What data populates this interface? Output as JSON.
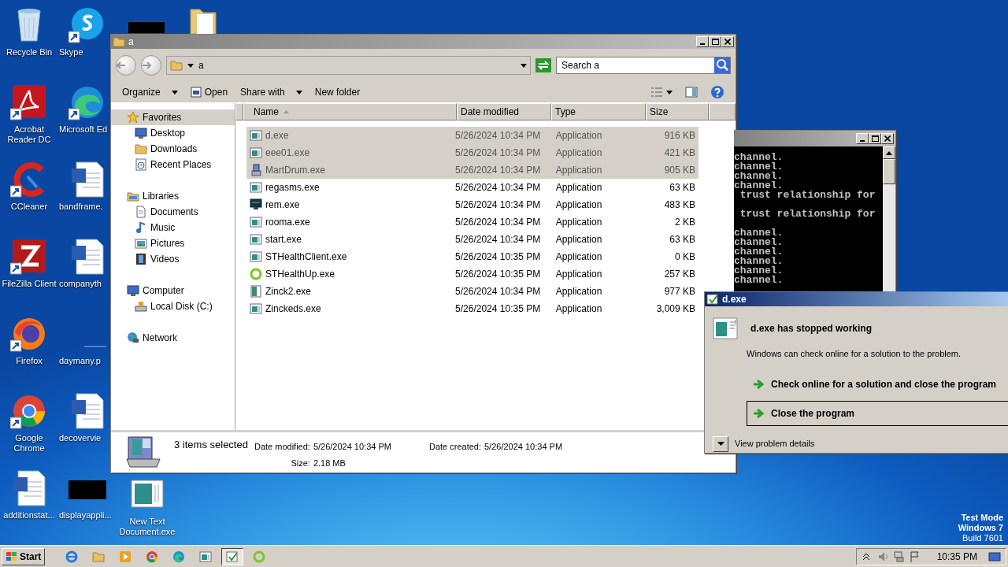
{
  "desktop": {
    "icons": [
      {
        "label": "Recycle Bin",
        "kind": "recycle",
        "shortcut": false
      },
      {
        "label": "Acrobat Reader DC",
        "kind": "acrobat",
        "shortcut": true
      },
      {
        "label": "CCleaner",
        "kind": "ccleaner",
        "shortcut": true
      },
      {
        "label": "FileZilla Client",
        "kind": "filezilla",
        "shortcut": true
      },
      {
        "label": "Firefox",
        "kind": "firefox",
        "shortcut": true
      },
      {
        "label": "Google Chrome",
        "kind": "chrome",
        "shortcut": true
      },
      {
        "label": "additionstat...",
        "kind": "word",
        "shortcut": false
      },
      {
        "label": "Skype",
        "kind": "skype",
        "shortcut": true
      },
      {
        "label": "Microsoft Ed",
        "kind": "edge",
        "shortcut": true
      },
      {
        "label": "bandframe.",
        "kind": "word",
        "shortcut": false
      },
      {
        "label": "companyth",
        "kind": "word",
        "shortcut": false
      },
      {
        "label": "daymany.p",
        "kind": "blank",
        "shortcut": false
      },
      {
        "label": "decovervie",
        "kind": "word",
        "shortcut": false
      },
      {
        "label": "displayappli...",
        "kind": "redacted",
        "shortcut": false
      }
    ],
    "loose_icons": [
      {
        "label": "New Text Document.exe",
        "kind": "exe",
        "shortcut": false
      }
    ],
    "info": [
      "Test Mode",
      "Windows 7",
      "Build 7601"
    ]
  },
  "explorer": {
    "title": "a",
    "address": "a",
    "search": {
      "placeholder": "Search a"
    },
    "toolbar": [
      {
        "label": "Organize",
        "kind": "text",
        "has_menu": true
      },
      {
        "label": "Open",
        "kind": "open",
        "has_menu": false
      },
      {
        "label": "Share with",
        "kind": "text",
        "has_menu": true
      },
      {
        "label": "New folder",
        "kind": "text",
        "has_menu": false
      }
    ],
    "sidebar": [
      {
        "label": "Favorites",
        "kind": "star",
        "selected": true,
        "children": [
          {
            "label": "Desktop",
            "kind": "desktop",
            "selected": false
          },
          {
            "label": "Downloads",
            "kind": "folder",
            "selected": false
          },
          {
            "label": "Recent Places",
            "kind": "recent",
            "selected": false
          }
        ]
      },
      {
        "label": "Libraries",
        "kind": "library",
        "selected": false,
        "children": [
          {
            "label": "Documents",
            "kind": "document",
            "selected": false
          },
          {
            "label": "Music",
            "kind": "music",
            "selected": false
          },
          {
            "label": "Pictures",
            "kind": "picture",
            "selected": false
          },
          {
            "label": "Videos",
            "kind": "video",
            "selected": false
          }
        ]
      },
      {
        "label": "Computer",
        "kind": "desktop",
        "selected": false,
        "children": [
          {
            "label": "Local Disk (C:)",
            "kind": "disk",
            "selected": false
          }
        ]
      },
      {
        "label": "Network",
        "kind": "network",
        "selected": false
      }
    ],
    "columns": [
      {
        "label": "Name",
        "sorted": true
      },
      {
        "label": "Date modified",
        "sorted": false
      },
      {
        "label": "Type",
        "sorted": false
      },
      {
        "label": "Size",
        "sorted": false
      }
    ],
    "rows": [
      {
        "name": "d.exe",
        "kind": "exe",
        "date": "5/26/2024 10:34 PM",
        "type": "Application",
        "size": "916 KB",
        "selected": true
      },
      {
        "name": "eee01.exe",
        "kind": "exe",
        "date": "5/26/2024 10:34 PM",
        "type": "Application",
        "size": "421 KB",
        "selected": true
      },
      {
        "name": "MartDrum.exe",
        "kind": "installer",
        "date": "5/26/2024 10:34 PM",
        "type": "Application",
        "size": "905 KB",
        "selected": true
      },
      {
        "name": "regasms.exe",
        "kind": "exe",
        "date": "5/26/2024 10:34 PM",
        "type": "Application",
        "size": "63 KB",
        "selected": false
      },
      {
        "name": "rem.exe",
        "kind": "monitor",
        "date": "5/26/2024 10:34 PM",
        "type": "Application",
        "size": "483 KB",
        "selected": false
      },
      {
        "name": "rooma.exe",
        "kind": "exe",
        "date": "5/26/2024 10:34 PM",
        "type": "Application",
        "size": "2 KB",
        "selected": false
      },
      {
        "name": "start.exe",
        "kind": "exe",
        "date": "5/26/2024 10:34 PM",
        "type": "Application",
        "size": "63 KB",
        "selected": false
      },
      {
        "name": "STHealthClient.exe",
        "kind": "exe",
        "date": "5/26/2024 10:35 PM",
        "type": "Application",
        "size": "0 KB",
        "selected": false
      },
      {
        "name": "STHealthUp.exe",
        "kind": "ring",
        "date": "5/26/2024 10:35 PM",
        "type": "Application",
        "size": "257 KB",
        "selected": false
      },
      {
        "name": "Zinck2.exe",
        "kind": "image",
        "date": "5/26/2024 10:34 PM",
        "type": "Application",
        "size": "977 KB",
        "selected": false
      },
      {
        "name": "Zinckeds.exe",
        "kind": "exe",
        "date": "5/26/2024 10:35 PM",
        "type": "Application",
        "size": "3,009 KB",
        "selected": false
      }
    ],
    "details": {
      "summary": "3 items selected",
      "fields": [
        {
          "label": "Date modified:",
          "value": "5/26/2024 10:34 PM"
        },
        {
          "label": "Date created:",
          "value": "5/26/2024 10:34 PM"
        },
        {
          "label": "Size:",
          "value": "2.18 MB"
        }
      ]
    }
  },
  "console": {
    "lines": [
      {
        "text": "channel.",
        "gap_before": false
      },
      {
        "text": "channel.",
        "gap_before": false
      },
      {
        "text": "channel.",
        "gap_before": false
      },
      {
        "text": "channel.",
        "gap_before": false
      },
      {
        "text": " trust relationship for",
        "gap_before": false
      },
      {
        "text": " trust relationship for",
        "gap_before": true
      },
      {
        "text": "channel.",
        "gap_before": true
      },
      {
        "text": "channel.",
        "gap_before": false
      },
      {
        "text": "channel.",
        "gap_before": false
      },
      {
        "text": "channel.",
        "gap_before": false
      },
      {
        "text": "channel.",
        "gap_before": false
      },
      {
        "text": "channel.",
        "gap_before": false
      }
    ]
  },
  "dialog": {
    "title": "d.exe",
    "heading": "d.exe has stopped working",
    "message": "Windows can check online for a solution to the problem.",
    "options": [
      {
        "label": "Check online for a solution and close the program",
        "selected": false
      },
      {
        "label": "Close the program",
        "selected": true
      }
    ],
    "details_toggle": {
      "label": "View problem details",
      "expanded": false
    }
  },
  "taskbar": {
    "start": "Start",
    "items": [
      {
        "kind": "ie",
        "pressed": false
      },
      {
        "kind": "folder",
        "pressed": false
      },
      {
        "kind": "media",
        "pressed": false
      },
      {
        "kind": "chrome",
        "pressed": false
      },
      {
        "kind": "edge",
        "pressed": false
      },
      {
        "kind": "exe",
        "pressed": false
      },
      {
        "kind": "crash",
        "pressed": true
      },
      {
        "kind": "ring",
        "pressed": false
      }
    ],
    "time": "10:35 PM"
  }
}
